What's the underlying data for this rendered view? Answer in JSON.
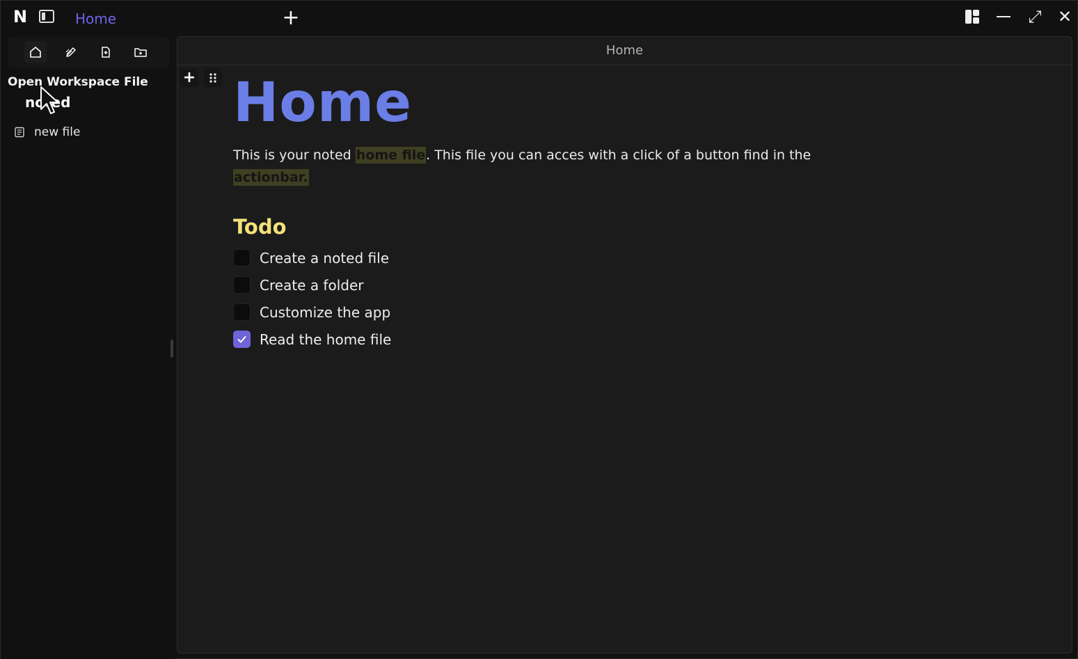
{
  "app": {
    "logo": "N",
    "tab_title": "Home",
    "new_tab": "+",
    "window_controls": {
      "maximize": "⤢",
      "close": "✕"
    }
  },
  "sidebar": {
    "actions": [
      {
        "icon": "home-icon"
      },
      {
        "icon": "edit-icon"
      },
      {
        "icon": "new-file-icon"
      },
      {
        "icon": "new-folder-icon"
      }
    ],
    "tooltip": "Open Workspace File",
    "workspace_name": "noted",
    "files": [
      {
        "name": "new file",
        "icon": "file-icon"
      }
    ]
  },
  "editor": {
    "header_title": "Home",
    "block_add": "+",
    "title": "Home",
    "para": {
      "p1": "This is your noted ",
      "h1": "home file",
      "p2": ". This file you can acces with a click of a button find in the ",
      "h2": "actionbar."
    },
    "todo_heading": "Todo",
    "todos": [
      {
        "label": "Create a noted file",
        "checked": false
      },
      {
        "label": "Create a folder",
        "checked": false
      },
      {
        "label": "Customize the app",
        "checked": false
      },
      {
        "label": "Read the home file",
        "checked": true
      }
    ]
  },
  "colors": {
    "accent": "#6e64e8",
    "title": "#6a7ee6",
    "heading": "#f2e27a",
    "highlight": "#3f3f22",
    "checkbox_checked": "#6f63d8"
  }
}
